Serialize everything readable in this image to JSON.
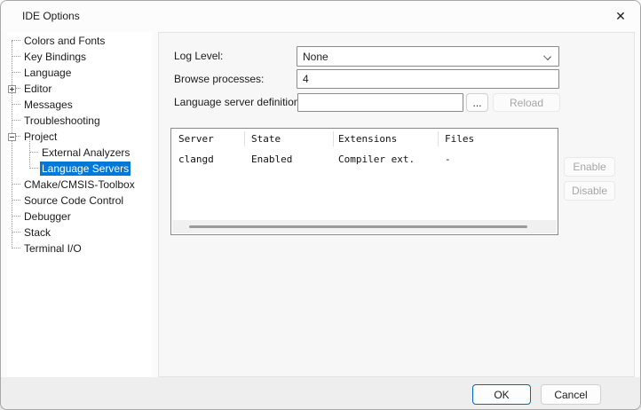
{
  "window": {
    "title": "IDE Options",
    "close_icon": "✕"
  },
  "sidebar": {
    "items": [
      {
        "label": "Colors and Fonts",
        "level": 1
      },
      {
        "label": "Key Bindings",
        "level": 1
      },
      {
        "label": "Language",
        "level": 1
      },
      {
        "label": "Editor",
        "level": 1,
        "expander": "plus"
      },
      {
        "label": "Messages",
        "level": 1
      },
      {
        "label": "Troubleshooting",
        "level": 1
      },
      {
        "label": "Project",
        "level": 1,
        "expander": "minus"
      },
      {
        "label": "External Analyzers",
        "level": 2
      },
      {
        "label": "Language Servers",
        "level": 2,
        "selected": true
      },
      {
        "label": "CMake/CMSIS-Toolbox",
        "level": 1
      },
      {
        "label": "Source Code Control",
        "level": 1
      },
      {
        "label": "Debugger",
        "level": 1
      },
      {
        "label": "Stack",
        "level": 1
      },
      {
        "label": "Terminal I/O",
        "level": 1
      }
    ]
  },
  "panel": {
    "log_level": {
      "label": "Log Level:",
      "value": "None"
    },
    "browse_processes": {
      "label": "Browse processes:",
      "value": "4"
    },
    "definitions": {
      "label": "Language server definitions:",
      "value": "",
      "browse_label": "...",
      "reload_label": "Reload"
    },
    "table": {
      "columns": [
        "Server",
        "State",
        "Extensions",
        "Files"
      ],
      "rows": [
        [
          "clangd",
          "Enabled",
          "Compiler ext.",
          "-"
        ]
      ]
    },
    "enable_label": "Enable",
    "disable_label": "Disable"
  },
  "footer": {
    "ok_label": "OK",
    "cancel_label": "Cancel"
  },
  "colors": {
    "selection": "#0078d7",
    "default_button_border": "#0067c0",
    "scrollbar_thumb": "#9a9a9a"
  }
}
